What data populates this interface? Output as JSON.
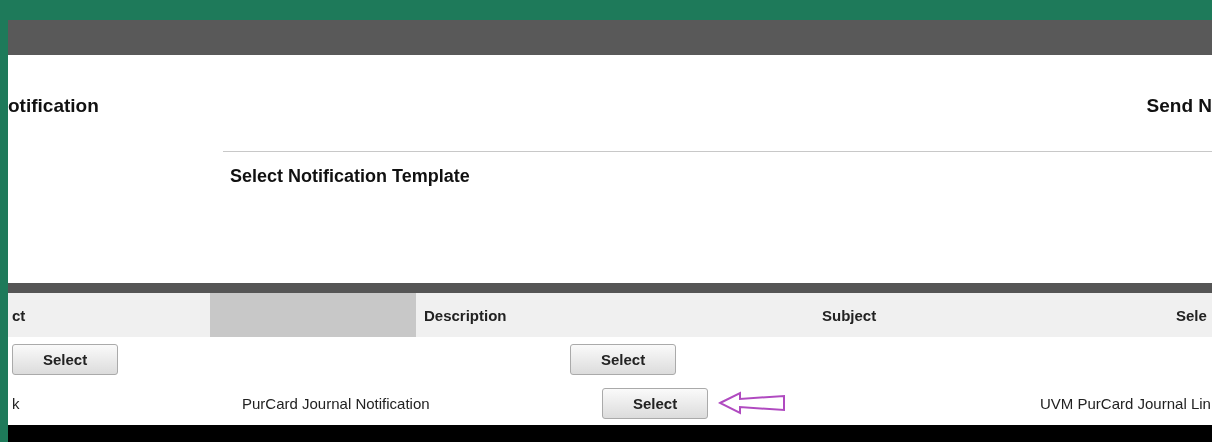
{
  "page": {
    "heading": "otification",
    "action": "Send N"
  },
  "section": {
    "title": "Select Notification Template"
  },
  "table": {
    "columns": [
      {
        "label": "ct"
      },
      {
        "label": "Description"
      },
      {
        "label": "Subject"
      },
      {
        "label": "Sele"
      }
    ],
    "rows": [
      {
        "kind": "buttons",
        "lead_button": "Select",
        "button": "Select"
      },
      {
        "kind": "record",
        "name": "k",
        "description": "PurCard Journal Notification",
        "button": "Select",
        "pointer": true,
        "subject": "UVM PurCard Journal Lin"
      }
    ]
  }
}
